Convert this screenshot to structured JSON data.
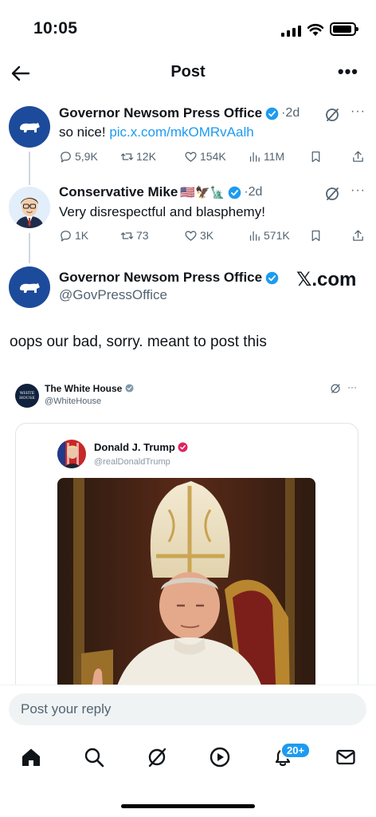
{
  "status_bar": {
    "time": "10:05"
  },
  "header": {
    "title": "Post"
  },
  "tweets": [
    {
      "name": "Governor Newsom Press Office",
      "time": "·2d",
      "text": "so nice! ",
      "link": "pic.x.com/mkOMRvAalh",
      "replies": "5,9K",
      "reposts": "12K",
      "likes": "154K",
      "views": "11M"
    },
    {
      "name": "Conservative Mike",
      "flags": "🇺🇸🦅🗽",
      "time": "·2d",
      "text": "Very disrespectful and blasphemy!",
      "replies": "1K",
      "reposts": "73",
      "likes": "3K",
      "views": "571K"
    }
  ],
  "main_post": {
    "name": "Governor Newsom Press Office",
    "handle": "@GovPressOffice",
    "watermark": "𝕏.com",
    "text": "oops our bad, sorry. meant to post this"
  },
  "embedded": {
    "account_name": "The White House",
    "account_handle": "@WhiteHouse",
    "avatar_text": "WHITE HOUSE",
    "quoted_name": "Donald J. Trump",
    "quoted_handle": "@realDonaldTrump"
  },
  "reply": {
    "placeholder": "Post your reply"
  },
  "tabbar": {
    "items": [
      "home",
      "search",
      "grok",
      "video",
      "notifications",
      "messages"
    ],
    "notification_badge": "20+"
  },
  "colors": {
    "accent": "#1d9bf0",
    "avatar_blue": "#1d4b9b",
    "muted": "#536471"
  }
}
